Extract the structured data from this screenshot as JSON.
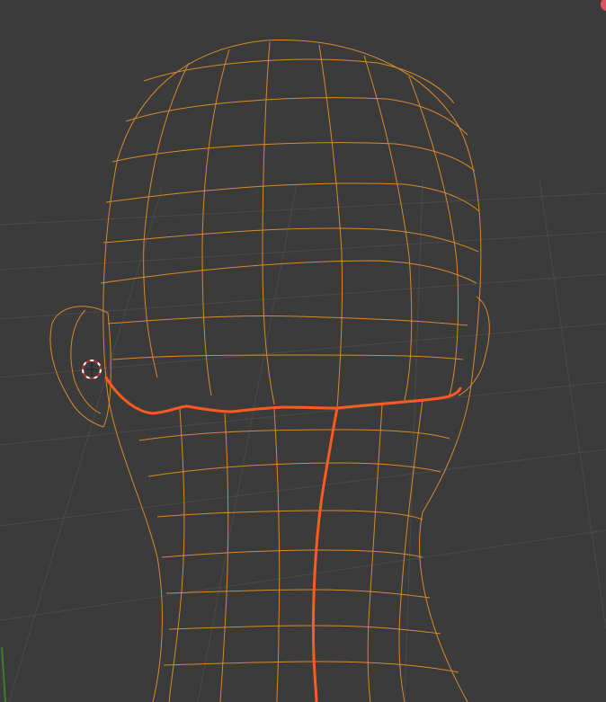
{
  "viewport": {
    "name": "3d-viewport",
    "background_color": "#3b3b3b",
    "grid_color": "#4a4a4a",
    "axis_y_color": "#3e7d26",
    "wire_color": "#d98a2a",
    "seam_color": "#ff5a1f",
    "gizmo_dot_color": "#e05060",
    "selected_object": "head-mesh",
    "mode": "edit-mode-wireframe"
  },
  "cursor": {
    "icon": "3d-cursor-icon",
    "ring_color_a": "#ffffff",
    "ring_color_b": "#c03030"
  }
}
